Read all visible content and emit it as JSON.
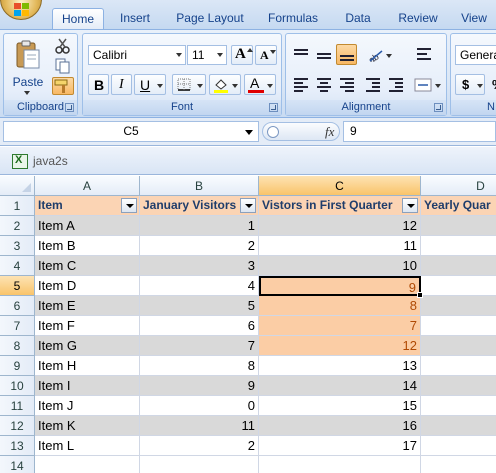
{
  "ribbon": {
    "tabs": [
      "Home",
      "Insert",
      "Page Layout",
      "Formulas",
      "Data",
      "Review",
      "View"
    ],
    "active_tab": "Home",
    "clipboard": {
      "paste_label": "Paste",
      "group_label": "Clipboard"
    },
    "font": {
      "name": "Calibri",
      "size": "11",
      "group_label": "Font",
      "bold": "B",
      "italic": "I",
      "underline": "U"
    },
    "alignment": {
      "group_label": "Alignment"
    },
    "number": {
      "format": "General",
      "currency": "$",
      "group_label": "N"
    }
  },
  "formula_bar": {
    "name_box": "C5",
    "fx": "fx",
    "value": "9"
  },
  "workbook": {
    "title": "java2s"
  },
  "grid": {
    "columns": [
      "A",
      "B",
      "C",
      "D"
    ],
    "selected_column": "C",
    "selected_row": 5,
    "active_cell": "C5",
    "headers": [
      "Item",
      "January Visitors",
      "Vistors in First Quarter",
      "Yearly Quar"
    ],
    "rows": [
      {
        "n": "1"
      },
      {
        "n": "2",
        "a": "Item A",
        "b": "1",
        "c": "12"
      },
      {
        "n": "3",
        "a": "Item B",
        "b": "2",
        "c": "11"
      },
      {
        "n": "4",
        "a": "Item C",
        "b": "3",
        "c": "10"
      },
      {
        "n": "5",
        "a": "Item D",
        "b": "4",
        "c": "9"
      },
      {
        "n": "6",
        "a": "Item E",
        "b": "5",
        "c": "8"
      },
      {
        "n": "7",
        "a": "Item F",
        "b": "6",
        "c": "7"
      },
      {
        "n": "8",
        "a": "Item G",
        "b": "7",
        "c": "12"
      },
      {
        "n": "9",
        "a": "Item H",
        "b": "8",
        "c": "13"
      },
      {
        "n": "10",
        "a": "Item I",
        "b": "9",
        "c": "14"
      },
      {
        "n": "11",
        "a": "Item J",
        "b": "0",
        "c": "15"
      },
      {
        "n": "12",
        "a": "Item K",
        "b": "11",
        "c": "16"
      },
      {
        "n": "13",
        "a": "Item L",
        "b": "2",
        "c": "17"
      },
      {
        "n": "14"
      }
    ]
  },
  "colors": {
    "header_fill": "#fbd4b4",
    "band_fill": "#d9d9d9",
    "highlight_fill": "#fbcda5",
    "highlight_text": "#b04a04",
    "ribbon_text": "#15428b"
  }
}
